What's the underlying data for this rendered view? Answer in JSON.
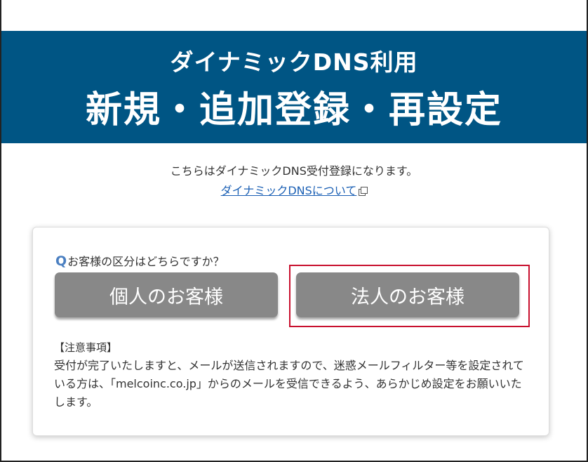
{
  "hero": {
    "subtitle": "ダイナミックDNS利用",
    "title": "新規・追加登録・再設定"
  },
  "intro": {
    "text": "こちらはダイナミックDNS受付登録になります。",
    "link_label": "ダイナミックDNSについて",
    "link_icon": "external-link-icon"
  },
  "card": {
    "question_mark": "Q",
    "question_text": "お客様の区分はどちらですか？",
    "buttons": {
      "individual": "個人のお客様",
      "corporate": "法人のお客様"
    },
    "notice_heading": "【注意事項】",
    "notice_body": "受付が完了いたしますと、メールが送信されますので、迷惑メールフィルター等を設定されている方は、「melcoinc.co.jp」からのメールを受信できるよう、あらかじめ設定をお願いいたします。"
  },
  "colors": {
    "hero_bg": "#005584",
    "button_bg": "#888888",
    "highlight_border": "#c8102e",
    "link": "#1a5fb4",
    "question_mark": "#4a7fc1"
  }
}
